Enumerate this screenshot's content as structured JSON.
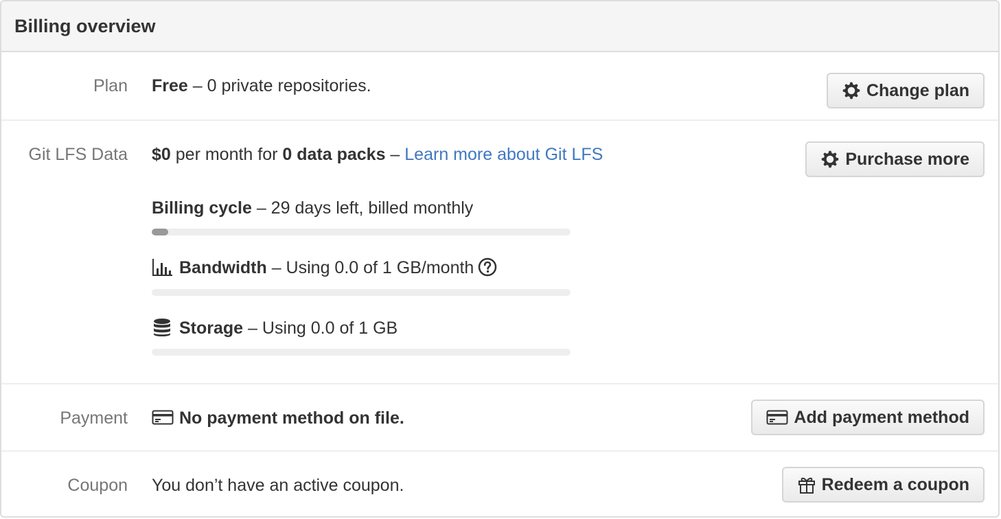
{
  "header": {
    "title": "Billing overview"
  },
  "plan": {
    "label": "Plan",
    "name": "Free",
    "description": " – 0 private repositories.",
    "button_label": "Change plan"
  },
  "lfs": {
    "label": "Git LFS Data",
    "price": "$0",
    "per_month_for": " per month for ",
    "packs": "0 data packs",
    "dash": " – ",
    "learn_more": "Learn more about Git LFS",
    "button_label": "Purchase more",
    "billing_cycle": {
      "title": "Billing cycle",
      "detail": " – 29 days left, billed monthly",
      "progress_fraction": 0.04
    },
    "bandwidth": {
      "title": "Bandwidth",
      "detail": " – Using 0.0 of 1 GB/month",
      "progress_fraction": 0.0
    },
    "storage": {
      "title": "Storage",
      "detail": " – Using 0.0 of 1 GB",
      "progress_fraction": 0.0
    }
  },
  "payment": {
    "label": "Payment",
    "status": "No payment method on file.",
    "button_label": "Add payment method"
  },
  "coupon": {
    "label": "Coupon",
    "status": "You don’t have an active coupon.",
    "button_label": "Redeem a coupon"
  },
  "colors": {
    "link": "#4078c0",
    "meter_track": "#eeeeee",
    "meter_fill": "#999999"
  },
  "icons": [
    "gear-icon",
    "graph-icon",
    "question-icon",
    "database-icon",
    "credit-card-icon",
    "gift-icon"
  ]
}
